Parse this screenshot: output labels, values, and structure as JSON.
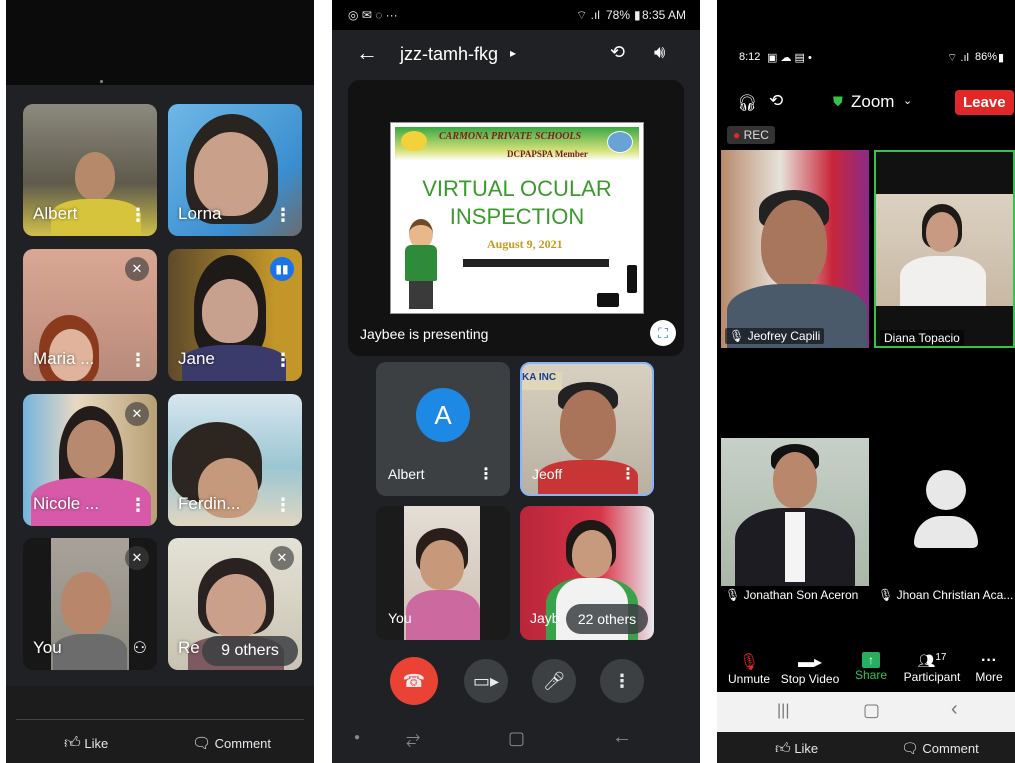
{
  "panel_meet_grid": {
    "tiles": [
      {
        "name": "Albert"
      },
      {
        "name": "Lorna"
      },
      {
        "name": "Maria ..."
      },
      {
        "name": "Jane"
      },
      {
        "name": "Nicole ..."
      },
      {
        "name": "Ferdin..."
      },
      {
        "name": "You"
      },
      {
        "name": "Re"
      }
    ],
    "others_label": "9 others",
    "facebook": {
      "like": "Like",
      "comment": "Comment"
    }
  },
  "panel_meet_present": {
    "status_bar": {
      "battery": "78%",
      "time": "8:35 AM"
    },
    "meeting_code": "jzz-tamh-fkg",
    "slide": {
      "banner_title": "CARMONA PRIVATE SCHOOLS",
      "banner_sub": "DCPAPSPA Member",
      "title_line1": "VIRTUAL OCULAR",
      "title_line2": "INSPECTION",
      "date": "August 9, 2021"
    },
    "presenting_text": "Jaybee is presenting",
    "tiles": [
      {
        "name": "Albert",
        "initial": "A"
      },
      {
        "name": "Jeoff"
      },
      {
        "name": "You"
      },
      {
        "name": "Jayb"
      }
    ],
    "others_label": "22 others",
    "colors": {
      "end_call": "#ea4335",
      "avatar": "#1e88e5",
      "active_border": "#8ab4f8"
    }
  },
  "panel_zoom": {
    "status_bar": {
      "time": "8:12",
      "battery": "86%"
    },
    "app_title": "Zoom",
    "leave_label": "Leave",
    "rec_label": "REC",
    "participants": [
      {
        "name": "Jeofrey Capili"
      },
      {
        "name": "Diana Topacio"
      },
      {
        "name": "Jonathan Son Aceron"
      },
      {
        "name": "Jhoan Christian Aca..."
      }
    ],
    "toolbar": {
      "unmute": "Unmute",
      "stop_video": "Stop Video",
      "share": "Share",
      "participants": "Participant",
      "participant_count": "17",
      "more": "More"
    },
    "facebook": {
      "like": "Like",
      "comment": "Comment"
    },
    "colors": {
      "leave": "#e02828",
      "share": "#27ae60",
      "active_border": "#35c44a"
    }
  }
}
